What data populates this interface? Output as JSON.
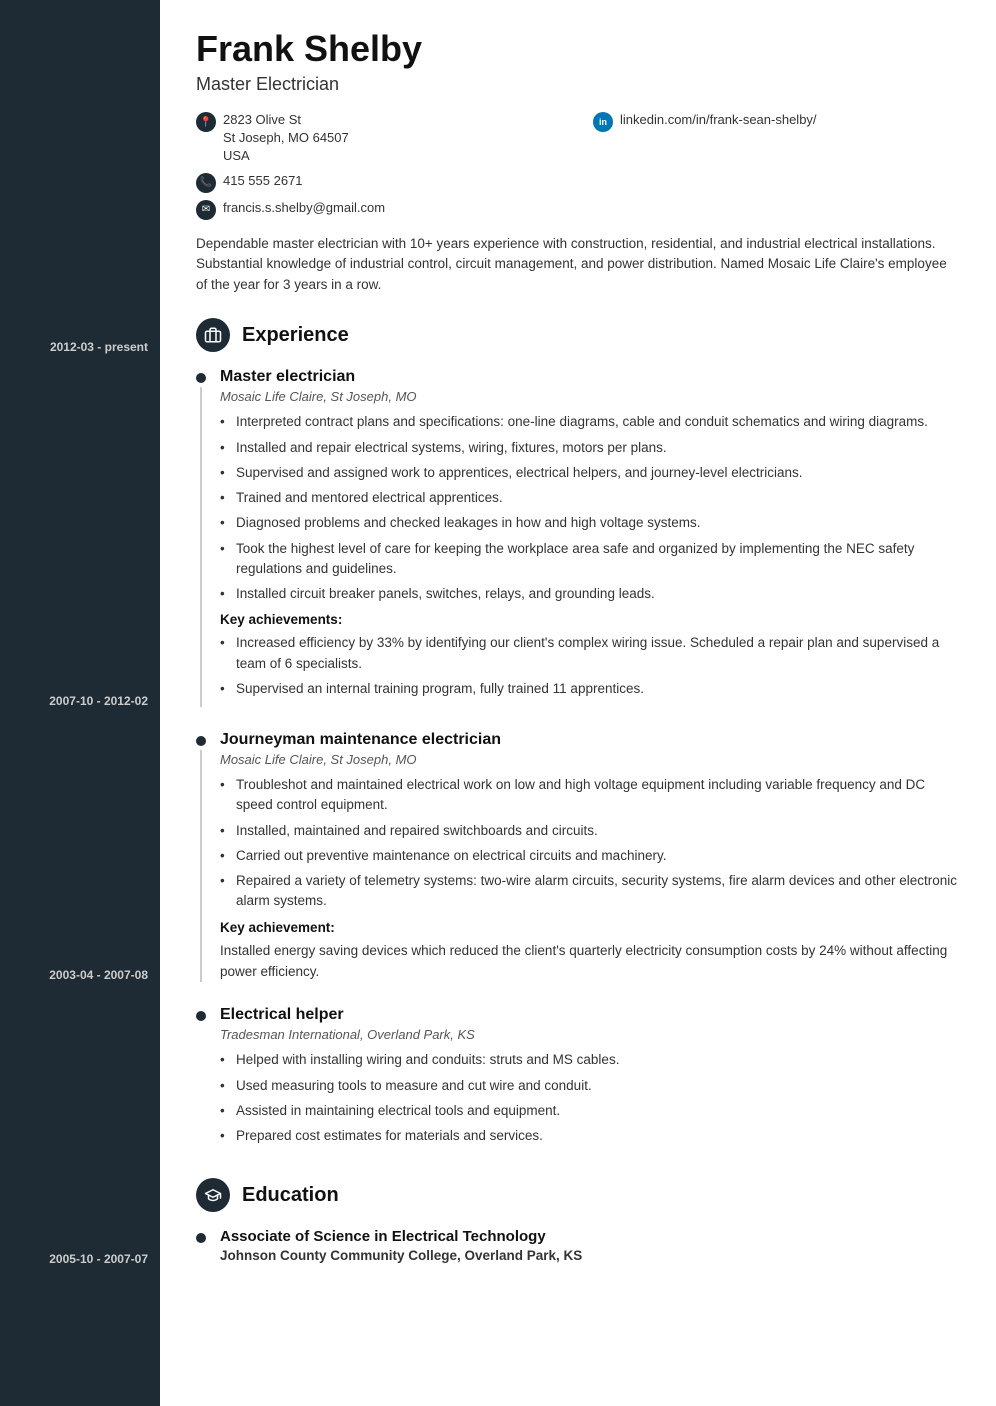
{
  "header": {
    "name": "Frank Shelby",
    "title": "Master Electrician"
  },
  "contact": {
    "address_line1": "2823 Olive St",
    "address_line2": "St Joseph, MO 64507",
    "address_line3": "USA",
    "phone": "415 555 2671",
    "email": "francis.s.shelby@gmail.com",
    "linkedin": "linkedin.com/in/frank-sean-shelby/"
  },
  "summary": "Dependable master electrician with 10+ years experience with construction, residential, and industrial electrical installations. Substantial knowledge of industrial control, circuit management, and power distribution. Named Mosaic Life Claire's employee of the year for 3 years in a row.",
  "sections": {
    "experience_label": "Experience",
    "education_label": "Education"
  },
  "experience": [
    {
      "date_range": "2012-03 - present",
      "job_title": "Master electrician",
      "company": "Mosaic Life Claire, St Joseph, MO",
      "bullets": [
        "Interpreted contract plans and specifications: one-line diagrams, cable and conduit schematics and wiring diagrams.",
        "Installed and repair electrical systems, wiring, fixtures, motors per plans.",
        "Supervised and assigned work to apprentices, electrical helpers, and journey-level electricians.",
        "Trained and mentored electrical apprentices.",
        "Diagnosed problems and checked leakages in how and high voltage systems.",
        "Took the highest level of care for keeping the workplace area safe and organized by implementing the NEC safety regulations and guidelines.",
        "Installed circuit breaker panels, switches, relays, and grounding leads."
      ],
      "key_achievements_label": "Key achievements:",
      "key_achievements": [
        "Increased efficiency by 33% by identifying our client's complex wiring issue. Scheduled a repair plan and supervised a team of 6 specialists.",
        "Supervised an internal training program, fully trained 11 apprentices."
      ]
    },
    {
      "date_range": "2007-10 - 2012-02",
      "job_title": "Journeyman maintenance electrician",
      "company": "Mosaic Life Claire, St Joseph, MO",
      "bullets": [
        "Troubleshot and maintained electrical work on low and high voltage equipment including variable frequency and DC speed control equipment.",
        "Installed, maintained and repaired switchboards and circuits.",
        "Carried out preventive maintenance on electrical circuits and machinery.",
        "Repaired a variety of telemetry systems: two-wire alarm circuits, security systems, fire alarm devices and other electronic alarm systems."
      ],
      "key_achievements_label": "Key achievement:",
      "key_achievements": [
        "Installed energy saving devices which reduced the client's quarterly electricity consumption costs by 24% without affecting power efficiency."
      ],
      "key_achievements_paragraph": true
    },
    {
      "date_range": "2003-04 - 2007-08",
      "job_title": "Electrical helper",
      "company": "Tradesman International, Overland Park, KS",
      "bullets": [
        "Helped with installing wiring and conduits: struts and MS cables.",
        "Used measuring tools to measure and cut wire and conduit.",
        "Assisted in maintaining electrical tools and equipment.",
        "Prepared cost estimates for materials and services."
      ],
      "key_achievements_label": null,
      "key_achievements": []
    }
  ],
  "education": [
    {
      "date_range": "2005-10 - 2007-07",
      "degree": "Associate of Science in Electrical Technology",
      "school": "Johnson County Community College, Overland Park, KS"
    }
  ]
}
